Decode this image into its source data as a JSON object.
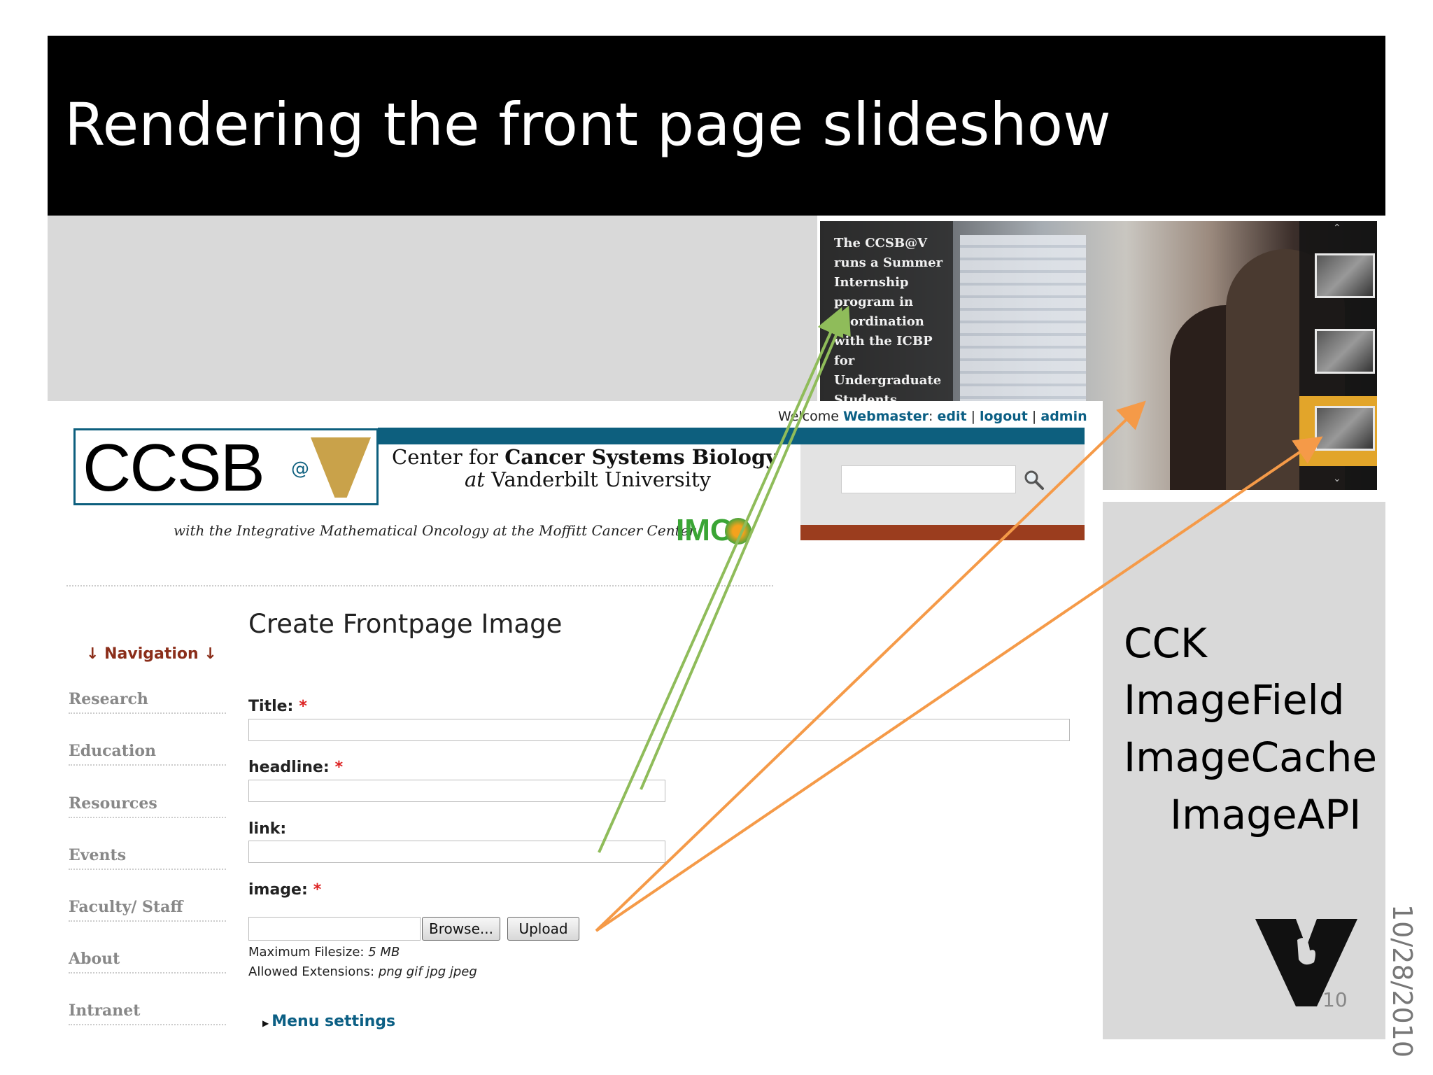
{
  "slide": {
    "title": "Rendering the front page slideshow",
    "modules": [
      "CCK",
      "ImageField",
      "ImageCache",
      "ImageAPI"
    ],
    "page_number": "10",
    "date": "10/28/2010"
  },
  "slideshow": {
    "caption": "The CCSB@V runs a Summer Internship program in coordination with the ICBP for Undergraduate Students."
  },
  "site": {
    "welcome_prefix": "Welcome",
    "user": "Webmaster",
    "links": [
      "edit",
      "logout",
      "admin"
    ],
    "logo_text": "CCSB",
    "logo_at": "@",
    "center_line1_prefix": "Center for",
    "center_line1_bold": "Cancer Systems Biology",
    "center_line2_prefix": "at",
    "center_line2_rest": "Vanderbilt University",
    "imo_line": "with the Integrative Mathematical Oncology at the Moffitt Cancer Center",
    "imo_logo": "IMO"
  },
  "nav": {
    "heading": "↓ Navigation ↓",
    "items": [
      "Research",
      "Education",
      "Resources",
      "Events",
      "Faculty/ Staff",
      "About",
      "Intranet"
    ]
  },
  "form": {
    "title": "Create Frontpage Image",
    "required_mark": "*",
    "title_label": "Title:",
    "headline_label": "headline:",
    "link_label": "link:",
    "image_label": "image:",
    "browse": "Browse...",
    "upload": "Upload",
    "max_filesize_label": "Maximum Filesize:",
    "max_filesize": "5 MB",
    "extensions_label": "Allowed Extensions:",
    "extensions": "png gif jpg jpeg",
    "menu_settings": "Menu settings"
  },
  "colors": {
    "teal": "#0d5f7e",
    "rust": "#9b3d1e",
    "green_arrow": "#8fbc5a",
    "orange_arrow": "#f59a48"
  }
}
